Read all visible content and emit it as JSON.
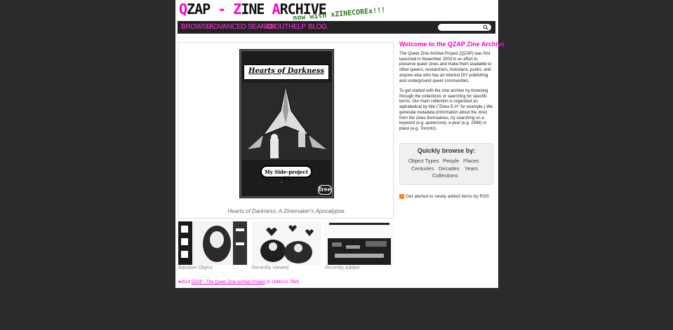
{
  "header": {
    "logo_parts": [
      "Q",
      "ZAP",
      " - ",
      "Z",
      "INE ",
      "A",
      "RCHIVE"
    ],
    "logo_sub": "now with xZINECOREx!!!"
  },
  "nav": {
    "items": [
      {
        "label": "BROWSE"
      },
      {
        "label": "ADVANCED SEARCH"
      },
      {
        "label": "ABOUT"
      },
      {
        "label": "HELP"
      },
      {
        "label": "BLOG"
      }
    ],
    "search_placeholder": ""
  },
  "featured": {
    "cover_title": "Hearts of Darkness",
    "cover_subtitle": "A Zinemaker's Apocalypse",
    "cover_label": "My Side-project #1",
    "cover_badge": "free",
    "caption": "Hearts of Darkness: A Zinemaker's Apocalypse"
  },
  "thumbnails": [
    {
      "label": "Random Object"
    },
    {
      "label": "Recently Viewed"
    },
    {
      "label": "Recently Added"
    }
  ],
  "footer": {
    "heart": "♥",
    "year": "2014 ",
    "link": "QZAP - The Queer Zine Archive Project",
    "stats": " (0.1348s/11.75M)"
  },
  "welcome": {
    "title": "Welcome to the QZAP Zine Archive",
    "p1": "The Queer Zine Archive Project (QZAP) was first launched in November 2003 in an effort to preserve queer zines and make them available to other queers, researchers, historians, punks, and anyone else who has an interest DIY publishing and underground queer communities.",
    "p2_a": "To get started with the zine archive try browsing through the collections or searching for specific terms. Our main collection is organized as alphabetical by title (\"Zines E-H\" for example.) We generate metadata (information about the zine) from the zines themselves, try searching on a keyword (e.g. ",
    "p2_e1": "queercore",
    "p2_b": "), a year (e.g. ",
    "p2_e2": "1996",
    "p2_c": ") or place (e.g. ",
    "p2_e3": "Toronto",
    "p2_d": ")."
  },
  "quick_browse": {
    "title": "Quickly browse by:",
    "links": [
      "Object Types",
      "People",
      "Places",
      "Centuries",
      "Decades",
      "Years",
      "Collections"
    ]
  },
  "rss": {
    "text": "Get alerted to newly added items by RSS"
  },
  "colors": {
    "accent": "#ff00cc",
    "nav_bg": "#222222",
    "page_bg": "#2b2b2b",
    "logo_sub": "#2d7a1f"
  }
}
